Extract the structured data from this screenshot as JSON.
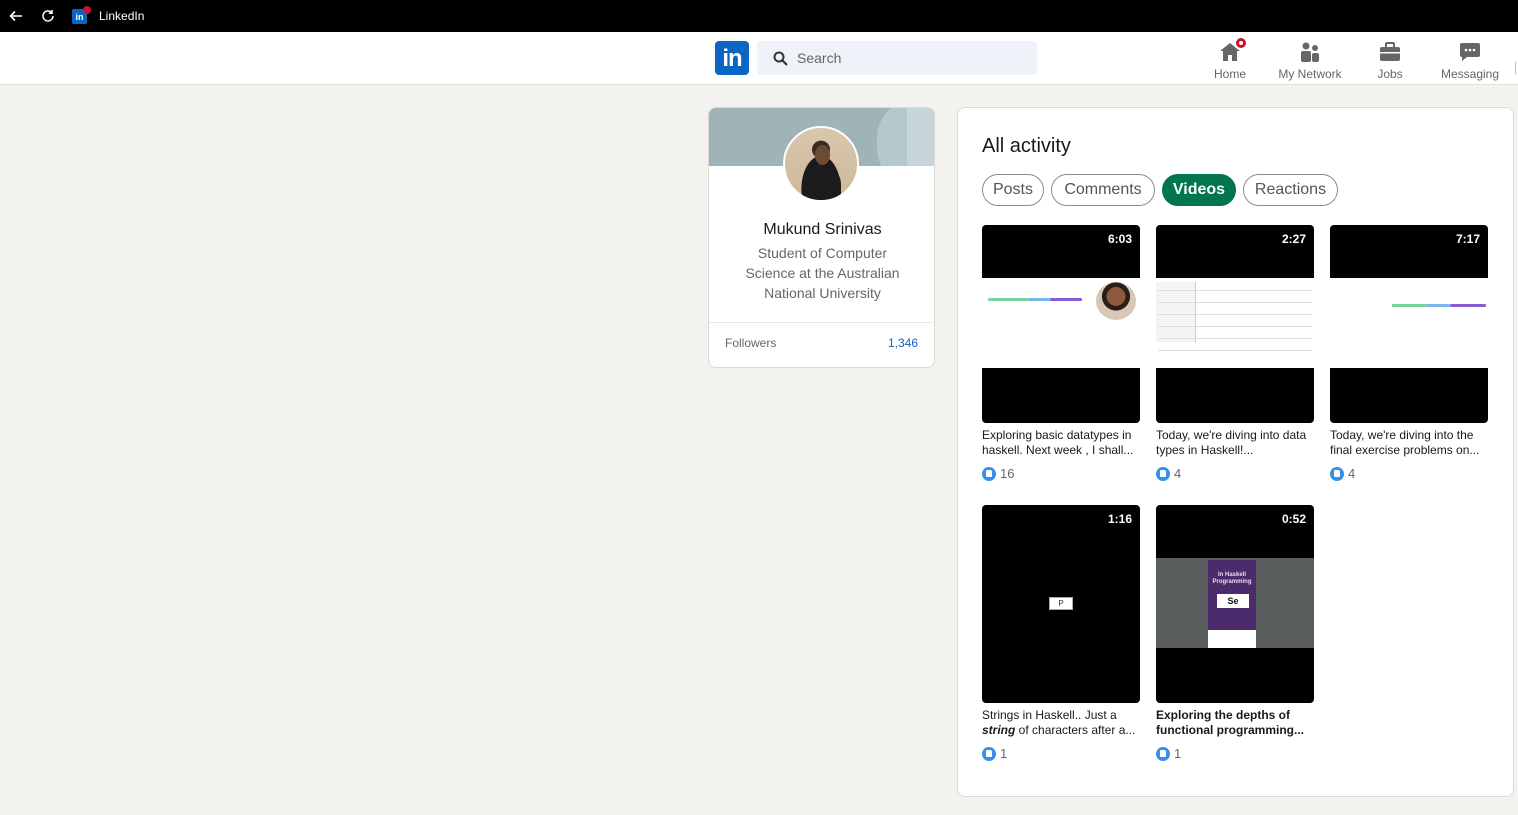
{
  "browser": {
    "title": "LinkedIn",
    "favicon_text": "in"
  },
  "nav": {
    "logo": "in",
    "search_placeholder": "Search",
    "items": [
      {
        "label": "Home",
        "icon": "home-icon"
      },
      {
        "label": "My Network",
        "icon": "network-icon"
      },
      {
        "label": "Jobs",
        "icon": "briefcase-icon"
      },
      {
        "label": "Messaging",
        "icon": "chat-icon"
      }
    ]
  },
  "profile": {
    "name": "Mukund Srinivas",
    "headline": "Student of Computer Science at the Australian National University",
    "followers_label": "Followers",
    "followers_count": "1,346"
  },
  "activity": {
    "title": "All activity",
    "filters": [
      "Posts",
      "Comments",
      "Videos",
      "Reactions"
    ],
    "active_filter": "Videos",
    "videos": [
      {
        "duration": "6:03",
        "caption": "Exploring basic datatypes in haskell. Next week , I shall...",
        "likes": "16"
      },
      {
        "duration": "2:27",
        "caption": "Today, we're diving into data types in Haskell!...",
        "likes": "4"
      },
      {
        "duration": "7:17",
        "caption": "Today, we're diving into the final exercise problems on...",
        "likes": "4"
      },
      {
        "duration": "1:16",
        "caption_pre": "Strings in Haskell.. Just a ",
        "caption_em": "string",
        "caption_post": " of characters after a...",
        "likes": "1"
      },
      {
        "duration": "0:52",
        "caption": "Exploring the depths of functional programming...",
        "likes": "1",
        "book_title": "In Haskell Programming",
        "book_box": "Se",
        "center_box": "P"
      }
    ]
  },
  "colors": {
    "brand": "#0a66c2",
    "active_pill": "#01754f",
    "page_bg": "#f3f2ef",
    "notification": "#cb112d"
  }
}
